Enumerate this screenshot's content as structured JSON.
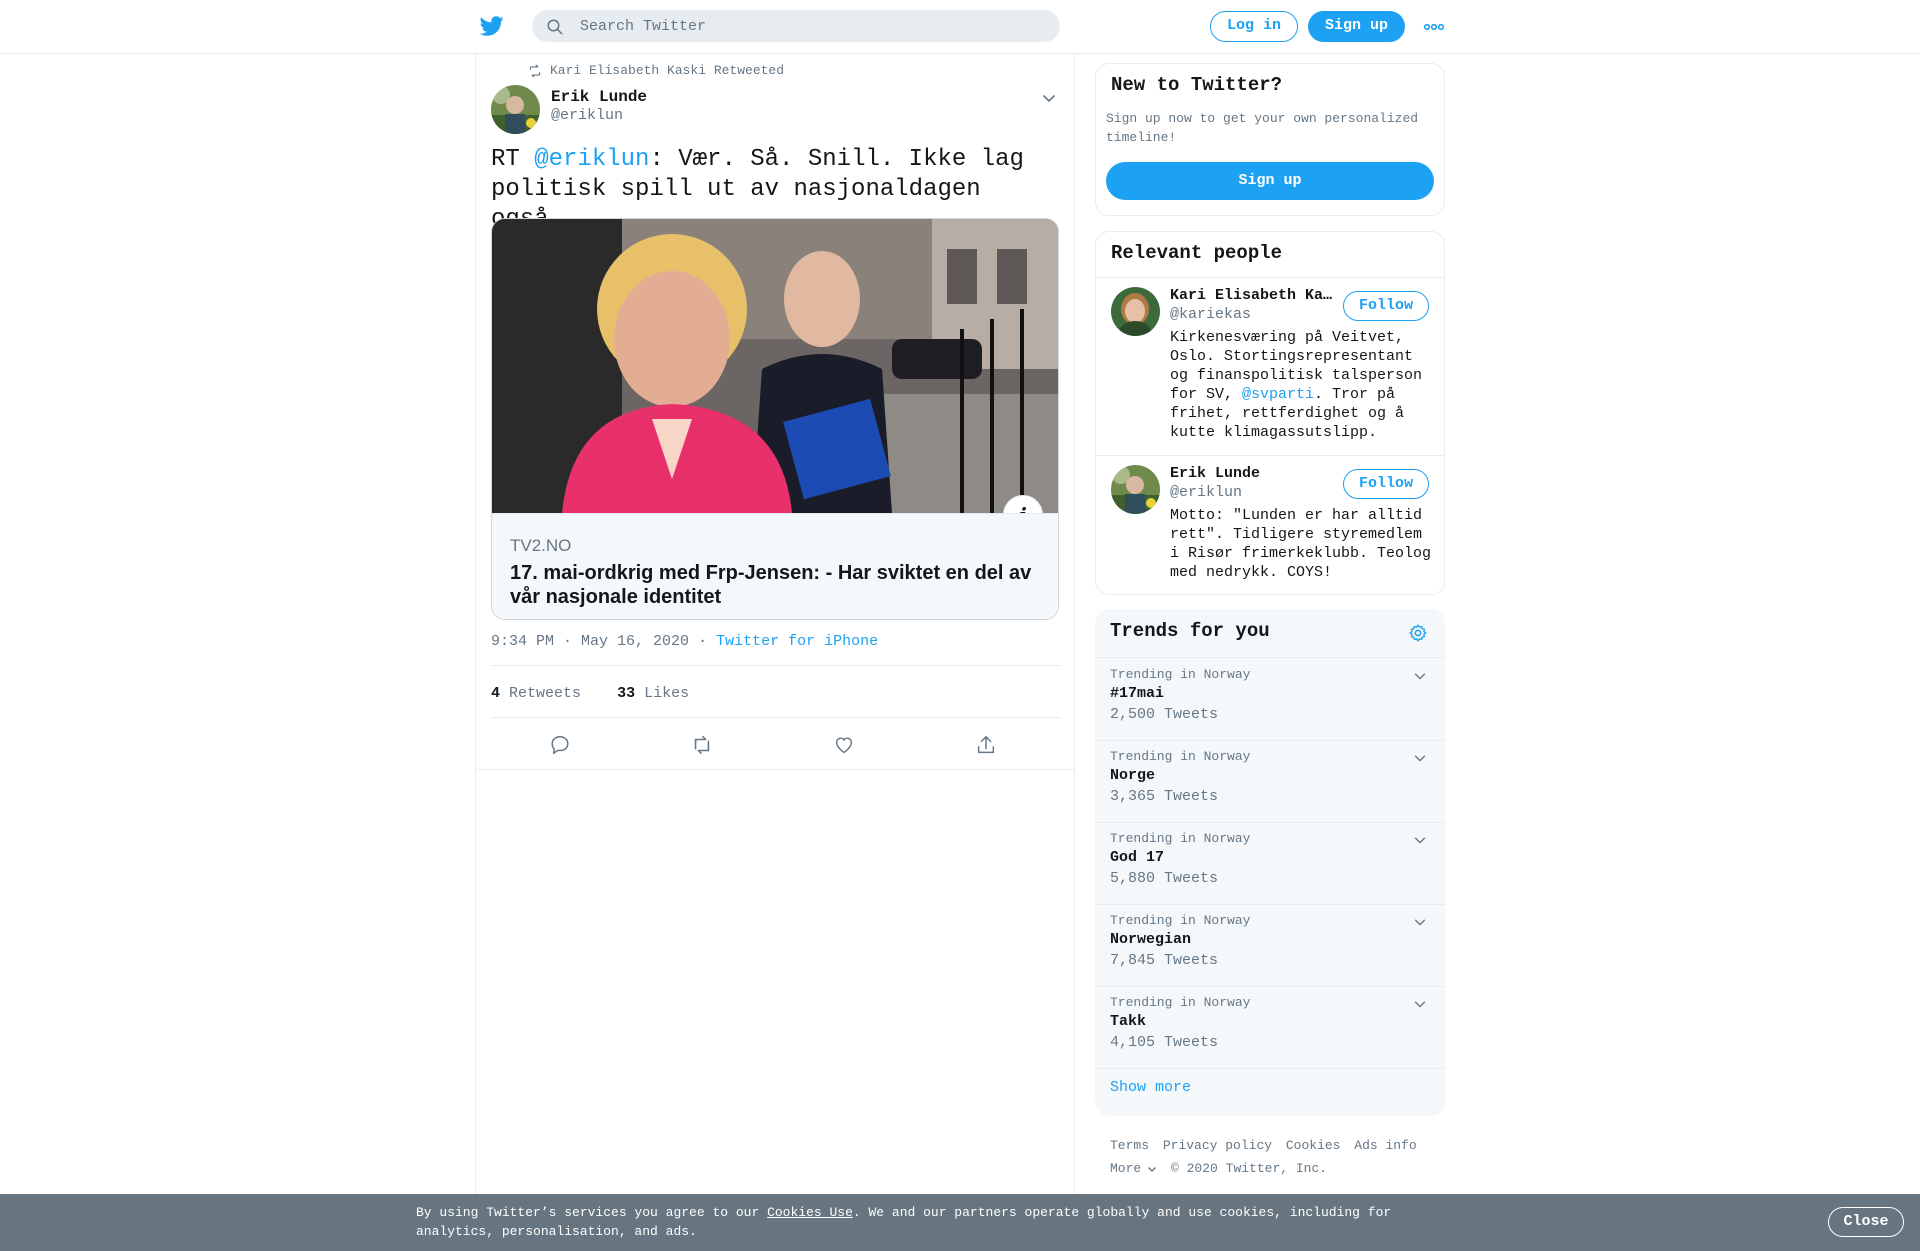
{
  "header": {
    "search_placeholder": "Search Twitter",
    "login_label": "Log in",
    "signup_label": "Sign up"
  },
  "tweet": {
    "retweeted_by": "Kari Elisabeth Kaski Retweeted",
    "author_name": "Erik Lunde",
    "author_handle": "@eriklun",
    "text_prefix": "RT ",
    "text_mention": "@eriklun",
    "text_body": ": Vær. Så. Snill. Ikke lag politisk spill ut av nasjonaldagen også.",
    "card": {
      "domain": "TV2.NO",
      "title": "17. mai-ordkrig med Frp-Jensen: - Har sviktet en del av vår nasjonale identitet",
      "info_icon_label": "i"
    },
    "timestamp": "9:34 PM · May 16, 2020",
    "separator": "·",
    "source": "Twitter for iPhone",
    "retweets_count": "4",
    "retweets_label": "Retweets",
    "likes_count": "33",
    "likes_label": "Likes"
  },
  "new_to_twitter": {
    "title": "New to Twitter?",
    "description": "Sign up now to get your own personalized timeline!",
    "button_label": "Sign up"
  },
  "relevant_people": {
    "title": "Relevant people",
    "people": [
      {
        "name": "Kari Elisabeth Kaski",
        "handle": "@kariekas",
        "bio_before": "Kirkenesværing på Veitvet, Oslo. Stortingsrepresentant og finanspolitisk talsperson for SV, ",
        "bio_mention": "@svparti",
        "bio_after": ". Tror på frihet, rettferdighet og å kutte klimagassutslipp.",
        "follow_label": "Follow"
      },
      {
        "name": "Erik Lunde",
        "handle": "@eriklun",
        "bio_before": "Motto: \"Lunden er har alltid rett\". Tidligere styremedlem i Risør frimerkeklubb. Teolog med nedrykk. COYS!",
        "bio_mention": "",
        "bio_after": "",
        "follow_label": "Follow"
      }
    ]
  },
  "trends": {
    "title": "Trends for you",
    "items": [
      {
        "context": "Trending in Norway",
        "name": "#17mai",
        "count": "2,500 Tweets"
      },
      {
        "context": "Trending in Norway",
        "name": "Norge",
        "count": "3,365 Tweets"
      },
      {
        "context": "Trending in Norway",
        "name": "God 17",
        "count": "5,880 Tweets"
      },
      {
        "context": "Trending in Norway",
        "name": "Norwegian",
        "count": "7,845 Tweets"
      },
      {
        "context": "Trending in Norway",
        "name": "Takk",
        "count": "4,105 Tweets"
      }
    ],
    "show_more": "Show more"
  },
  "footer": {
    "links": [
      "Terms",
      "Privacy policy",
      "Cookies",
      "Ads info"
    ],
    "more_label": "More",
    "copyright": "© 2020 Twitter, Inc."
  },
  "cookie_bar": {
    "text_before": "By using Twitter’s services you agree to our ",
    "link": "Cookies Use",
    "text_after": ". We and our partners operate globally and use cookies, including for analytics, personalisation, and ads.",
    "close_label": "Close"
  },
  "colors": {
    "accent": "#1da1f2",
    "text_primary": "#14171a",
    "text_secondary": "#657786",
    "cookie_bar": "#66757f"
  }
}
